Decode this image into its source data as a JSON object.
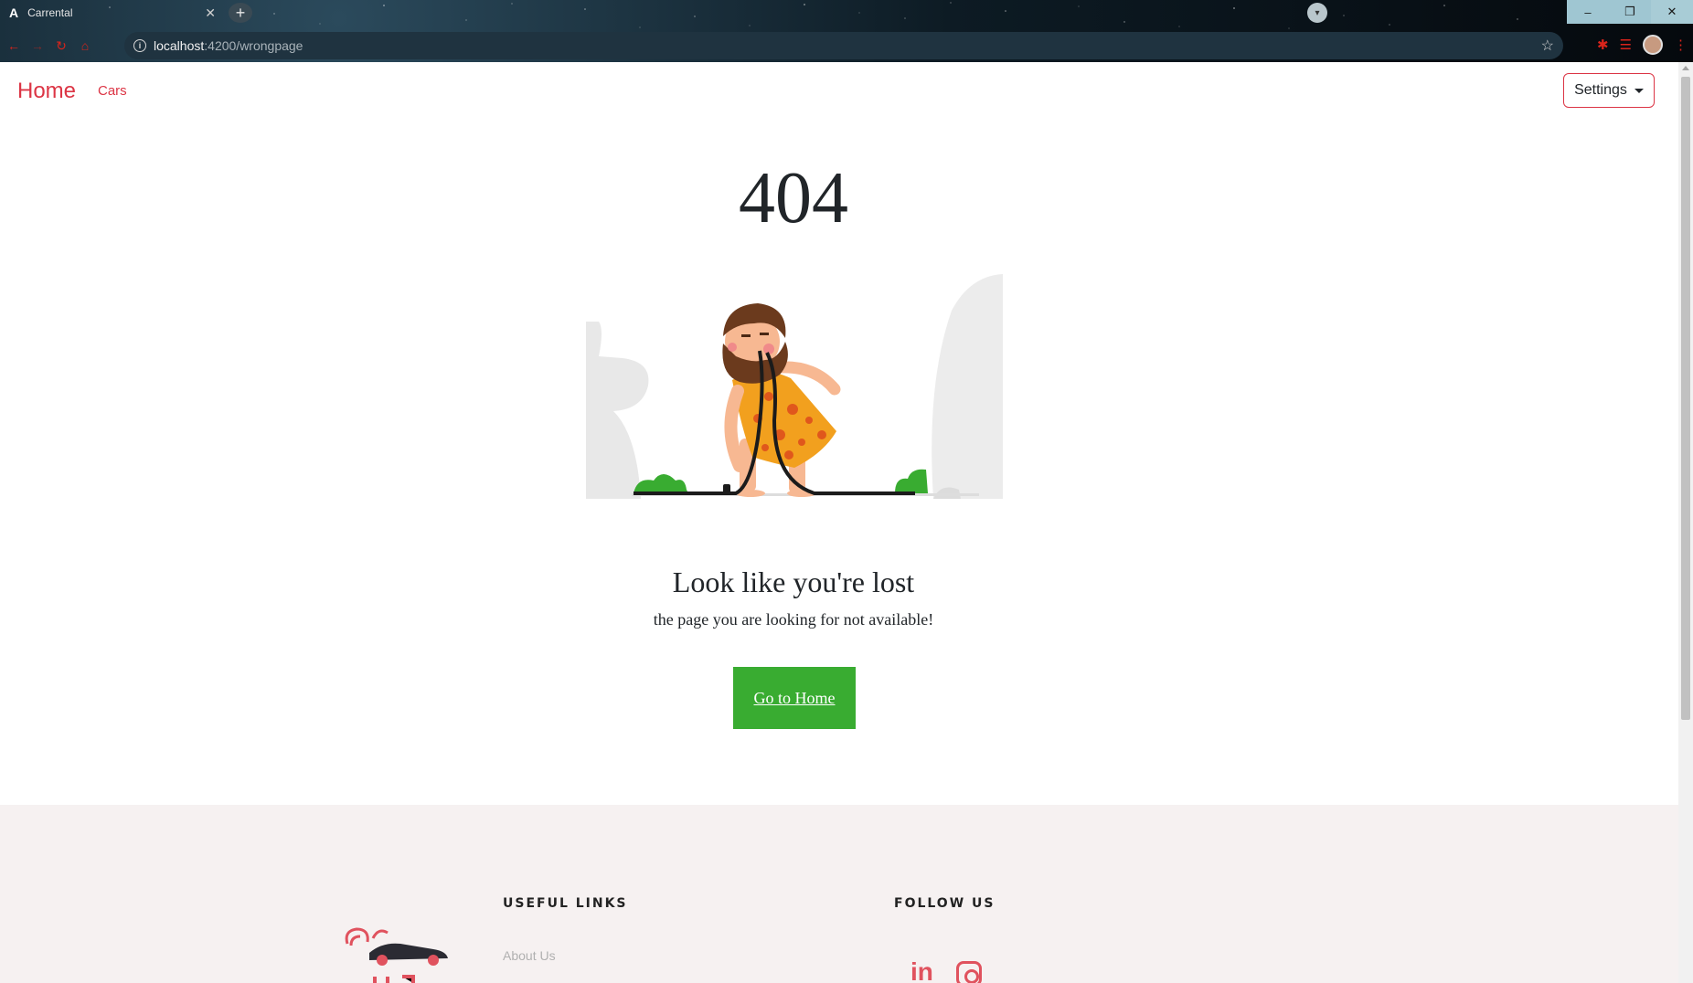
{
  "browser": {
    "tab_title": "Carrental",
    "tab_favicon": "A",
    "tab_close": "✕",
    "new_tab": "+",
    "url_host": "localhost",
    "url_path": ":4200/wrongpage",
    "window_controls": [
      "–",
      "❐",
      "✕"
    ]
  },
  "navbar": {
    "brand": "Home",
    "links": [
      "Cars"
    ],
    "settings_label": "Settings"
  },
  "error": {
    "code": "404",
    "heading": "Look like you're lost",
    "subtext": "the page you are looking for not available!",
    "button": "Go to Home"
  },
  "footer": {
    "useful_links_heading": "USEFUL LINKS",
    "follow_us_heading": "FOLLOW US",
    "links": [
      "About Us"
    ],
    "social": [
      "linkedin-icon",
      "instagram-icon"
    ],
    "linkedin_text": "in"
  },
  "colors": {
    "primary": "#dc3545",
    "button_green": "#39ac31",
    "footer_bg": "#f6f1f1"
  }
}
